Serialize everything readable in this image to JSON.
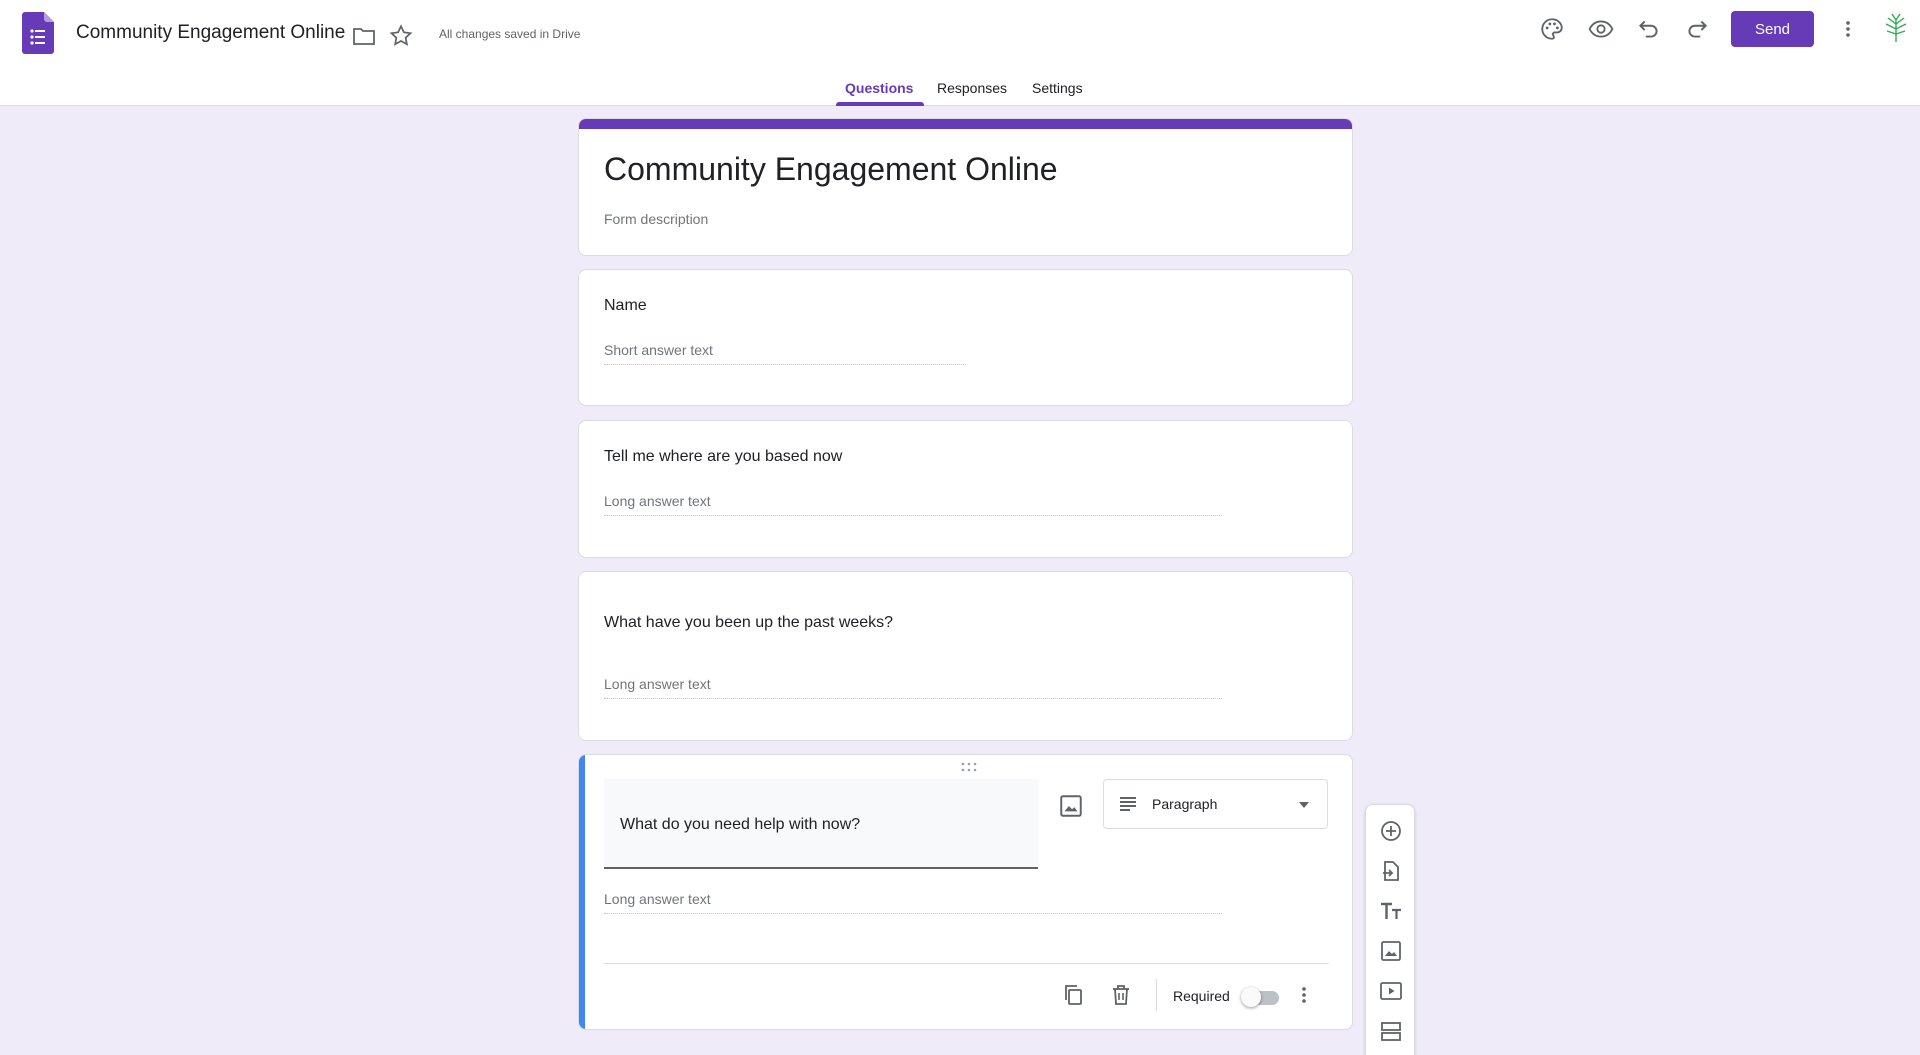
{
  "header": {
    "doc_title": "Community Engagement Online",
    "save_status": "All changes saved in Drive",
    "send_label": "Send"
  },
  "tabs": [
    {
      "label": "Questions",
      "active": true
    },
    {
      "label": "Responses",
      "active": false
    },
    {
      "label": "Settings",
      "active": false
    }
  ],
  "form": {
    "title": "Community Engagement Online",
    "description_placeholder": "Form description"
  },
  "questions": [
    {
      "title": "Name",
      "answer_hint": "Short answer text"
    },
    {
      "title": "Tell me where are you based now",
      "answer_hint": "Long answer text"
    },
    {
      "title": "What have you been up the past weeks?",
      "answer_hint": "Long answer text"
    },
    {
      "title": "What do you need help with now?",
      "answer_hint": "Long answer text",
      "type": "Paragraph",
      "required_label": "Required",
      "required": false
    }
  ],
  "icons": {
    "app": "forms-logo-icon",
    "folder": "folder-icon",
    "star": "star-icon",
    "palette": "palette-icon",
    "preview": "eye-icon",
    "undo": "undo-icon",
    "redo": "redo-icon",
    "more": "more-vert-icon"
  },
  "colors": {
    "accent": "#673ab7",
    "active_bar": "#4285f4",
    "background": "#f0ebf8"
  }
}
